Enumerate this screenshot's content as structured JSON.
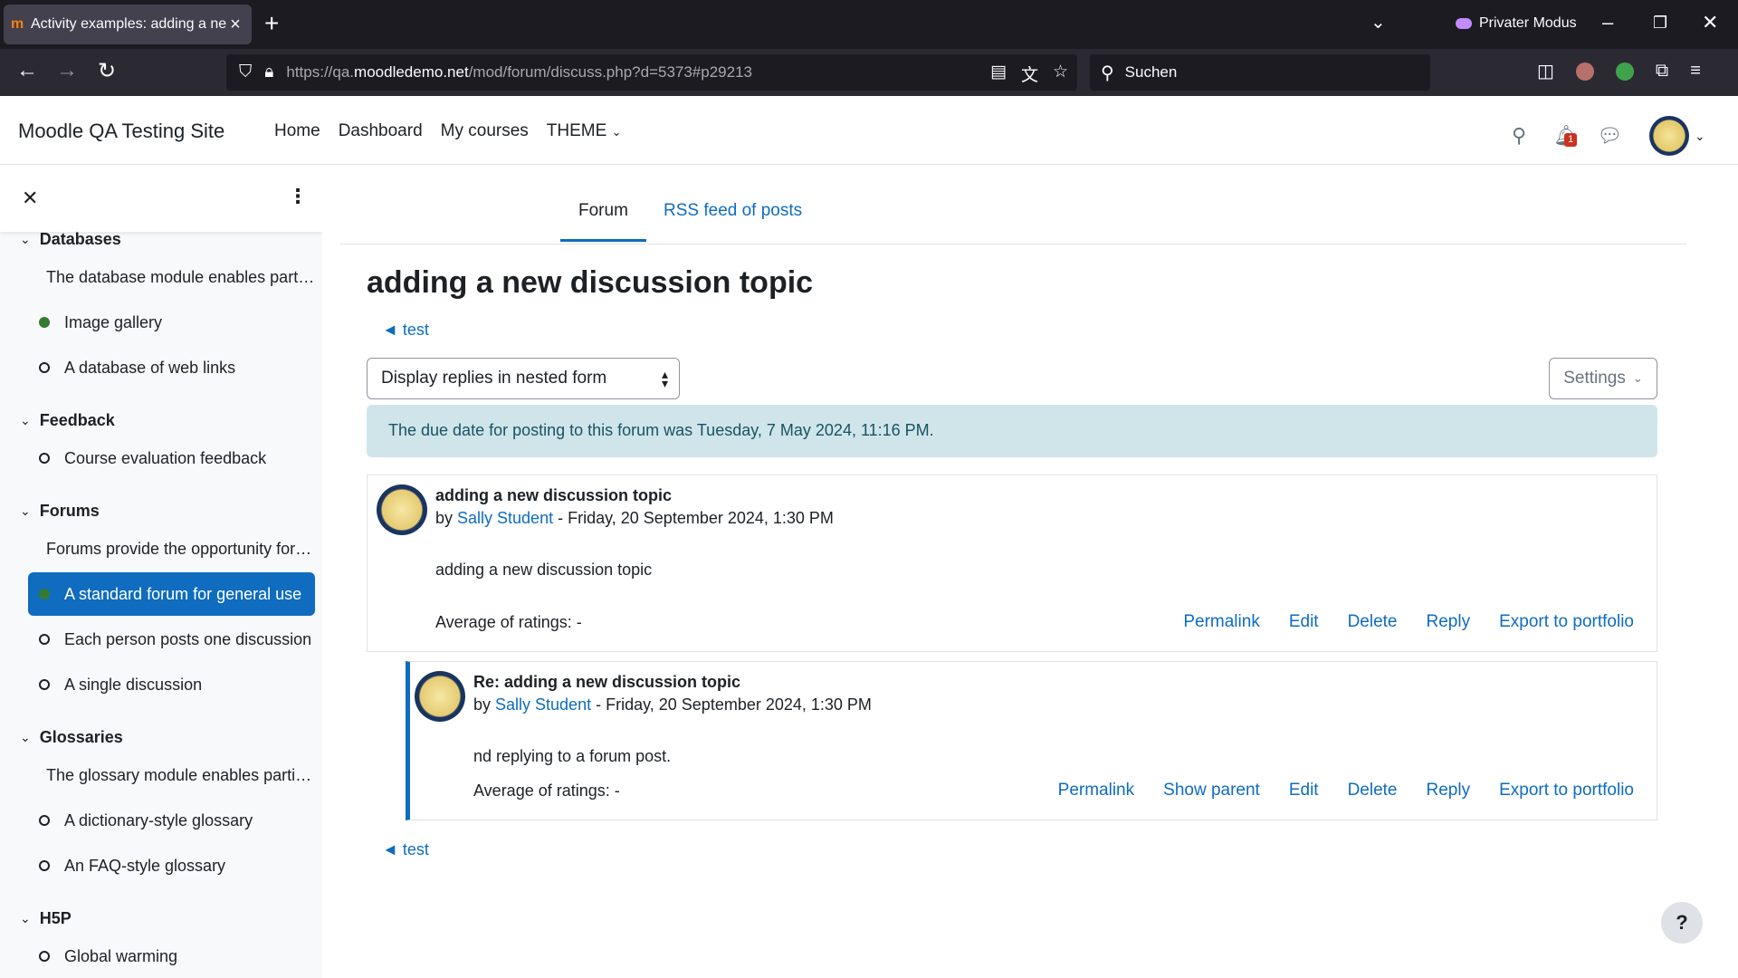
{
  "browser": {
    "tab_title": "Activity examples: adding a new discussion topic",
    "private_label": "Privater Modus",
    "url_prefix": "https://qa.",
    "url_domain": "moodledemo.net",
    "url_path": "/mod/forum/discuss.php?d=5373#p29213",
    "search_placeholder": "Suchen"
  },
  "header": {
    "site_name": "Moodle QA Testing Site",
    "nav": [
      "Home",
      "Dashboard",
      "My courses",
      "THEME"
    ],
    "notification_count": "1"
  },
  "drawer": {
    "sections": [
      {
        "label": "Databases"
      },
      {
        "label": "Feedback"
      },
      {
        "label": "Forums"
      },
      {
        "label": "Glossaries"
      },
      {
        "label": "H5P"
      }
    ],
    "items": [
      {
        "label": "The database module enables participants to create, maintain and search a bank of record entries."
      },
      {
        "label": "Image gallery"
      },
      {
        "label": "A database of web links"
      },
      {
        "label": "Course evaluation feedback"
      },
      {
        "label": "Forums provide the opportunity for discussion."
      },
      {
        "label": "A standard forum for general use"
      },
      {
        "label": "Each person posts one discussion"
      },
      {
        "label": "A single discussion"
      },
      {
        "label": "The glossary module enables participants to create and maintain a list of definitions."
      },
      {
        "label": "A dictionary-style glossary"
      },
      {
        "label": "An FAQ-style glossary"
      },
      {
        "label": "Global warming"
      }
    ]
  },
  "main": {
    "tabs": [
      "Forum",
      "RSS feed of posts"
    ],
    "title": "adding a new discussion topic",
    "back_link": "◄ test",
    "display_mode": "Display replies in nested form",
    "settings_label": "Settings",
    "alert": "The due date for posting to this forum was Tuesday, 7 May 2024, 11:16 PM.",
    "posts": [
      {
        "title": "adding a new discussion topic",
        "by": "by ",
        "author": "Sally Student",
        "date": " - Friday, 20 September 2024, 1:30 PM",
        "body": "adding a new discussion topic",
        "ratings": "Average of ratings: -",
        "actions": [
          "Permalink",
          "Edit",
          "Delete",
          "Reply",
          "Export to portfolio"
        ]
      },
      {
        "title": "Re: adding a new discussion topic",
        "by": "by ",
        "author": "Sally Student",
        "date": " - Friday, 20 September 2024, 1:30 PM",
        "body": "nd replying to a forum post.",
        "ratings": "Average of ratings: -",
        "actions": [
          "Permalink",
          "Show parent",
          "Edit",
          "Delete",
          "Reply",
          "Export to portfolio"
        ]
      }
    ],
    "help_label": "?"
  },
  "colors": {
    "accent": "#0f6cbf",
    "alert_bg": "#cfe5ea",
    "complete_dot": "#357a32"
  }
}
